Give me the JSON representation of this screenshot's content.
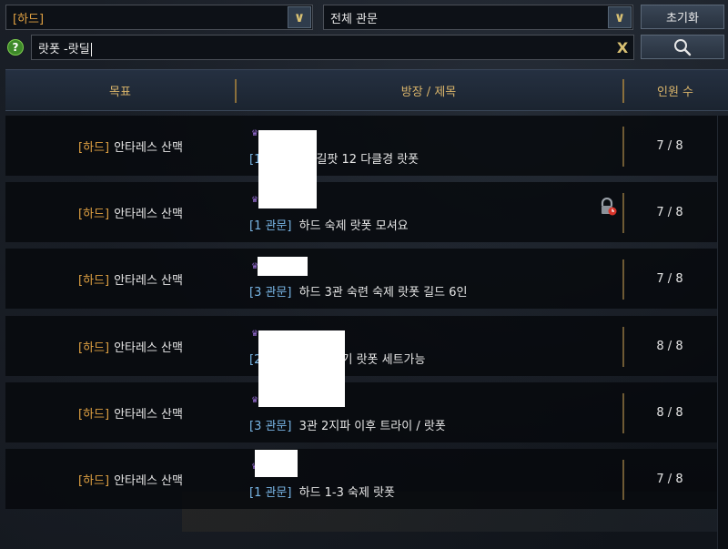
{
  "filters": {
    "difficulty": "[하드]",
    "gate": "전체 관문",
    "reset_label": "초기화",
    "help_symbol": "?",
    "search_value": "랏폿 -랏딜",
    "clear_symbol": "X"
  },
  "columns": {
    "goal": "목표",
    "title": "방장 / 제목",
    "count": "인원 수"
  },
  "rows": [
    {
      "difficulty": "[하드]",
      "raid": "안타레스 산맥",
      "gate": "[1",
      "title": "길팟 12 다클경 랏폿",
      "count": "7 / 8"
    },
    {
      "difficulty": "[하드]",
      "raid": "안타레스 산맥",
      "gate": "[1 관문]",
      "title": "하드 숙제 랏폿 모셔요",
      "count": "7 / 8"
    },
    {
      "difficulty": "[하드]",
      "raid": "안타레스 산맥",
      "gate": "[3 관문]",
      "title": "하드 3관 숙련 숙제 랏폿 길드 6인",
      "count": "7 / 8"
    },
    {
      "difficulty": "[하드]",
      "raid": "안타레스 산맥",
      "gate": "[2",
      "title": "기 랏폿 세트가능",
      "count": "8 / 8"
    },
    {
      "difficulty": "[하드]",
      "raid": "안타레스 산맥",
      "gate": "[3 관문]",
      "title": "3관 2지파 이후 트라이 / 랏폿",
      "count": "8 / 8"
    },
    {
      "difficulty": "[하드]",
      "raid": "안타레스 산맥",
      "gate": "[1 관문]",
      "title": "하드 1-3 숙제 랏폿",
      "count": "7 / 8"
    }
  ],
  "colors": {
    "difficulty": "#e0a142",
    "gate": "#79b6e6",
    "header_text": "#d9b46a"
  }
}
